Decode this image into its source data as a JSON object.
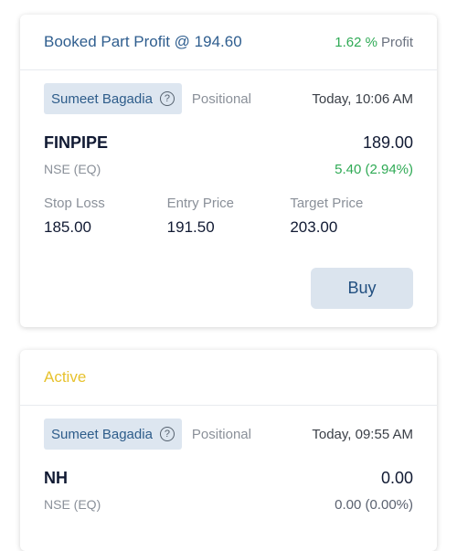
{
  "cards": [
    {
      "status_text": "Booked Part Profit @ 194.60",
      "profit_pct": "1.62 %",
      "profit_label": "Profit",
      "analyst": "Sumeet Bagadia",
      "help_glyph": "?",
      "category": "Positional",
      "time": "Today, 10:06 AM",
      "symbol": "FINPIPE",
      "price": "189.00",
      "exchange": "NSE (EQ)",
      "change": "5.40 (2.94%)",
      "stop_loss_label": "Stop Loss",
      "stop_loss": "185.00",
      "entry_price_label": "Entry Price",
      "entry_price": "191.50",
      "target_price_label": "Target Price",
      "target_price": "203.00",
      "action_label": "Buy"
    },
    {
      "status_text": "Active",
      "analyst": "Sumeet Bagadia",
      "help_glyph": "?",
      "category": "Positional",
      "time": "Today, 09:55 AM",
      "symbol": "NH",
      "price": "0.00",
      "exchange": "NSE (EQ)",
      "change": "0.00 (0.00%)"
    }
  ],
  "colors": {
    "booked_status": "#2f5e8f",
    "active_status": "#e7c22e",
    "positive": "#2faa55",
    "chip_bg": "#dde6f0"
  },
  "icons": {
    "help": "help-question-icon"
  }
}
